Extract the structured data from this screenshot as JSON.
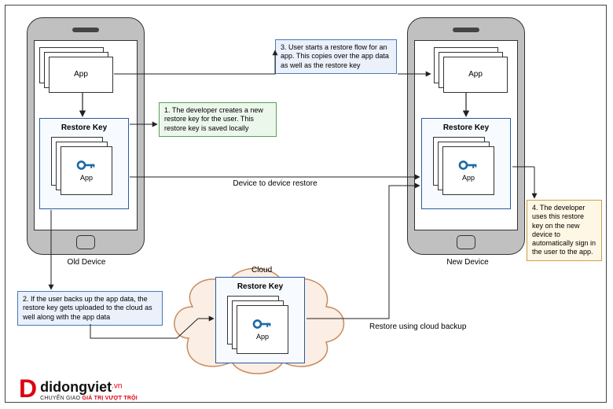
{
  "devices": {
    "old": "Old Device",
    "new": "New Device"
  },
  "labels": {
    "app": "App",
    "restore_key": "Restore Key",
    "cloud": "Cloud",
    "d2d": "Device to device restore",
    "cloud_restore": "Restore using cloud backup"
  },
  "notes": {
    "n1": "1. The developer creates a new restore key for the user. This restore key is saved locally",
    "n2": "2. If the user backs up the app data, the restore key gets uploaded to the cloud as well along with the app data",
    "n3": "3. User starts a restore flow for an app. This copies over the app data as well as the restore key",
    "n4": "4. The developer uses this restore key on the new device to automatically sign in the user to the app."
  },
  "logo": {
    "mark": "D",
    "name": "didongviet",
    "tld": ".vn",
    "sub_prefix": "CHUYỂN GIAO ",
    "sub_highlight": "GIÁ TRỊ VƯỢT TRỘI"
  }
}
